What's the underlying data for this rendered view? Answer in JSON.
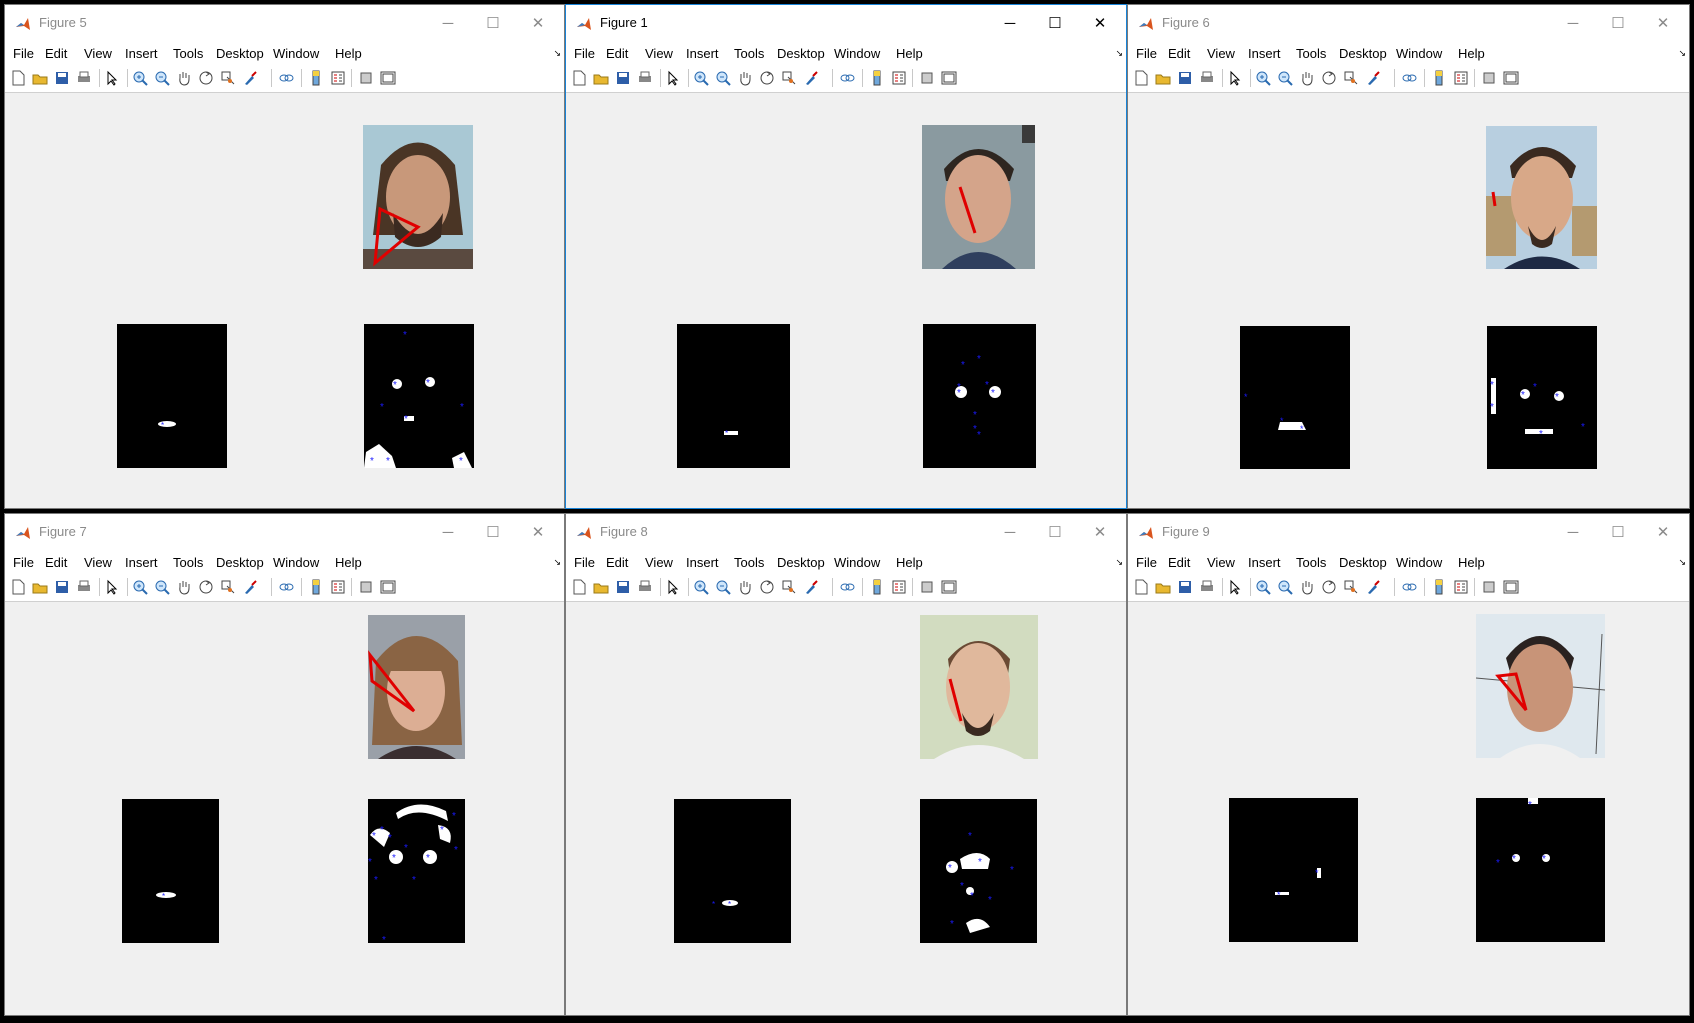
{
  "menu": [
    "File",
    "Edit",
    "View",
    "Insert",
    "Tools",
    "Desktop",
    "Window",
    "Help"
  ],
  "window_controls": {
    "minimize": "─",
    "maximize": "☐",
    "close": "✕"
  },
  "toolbar_icons": [
    "new-figure-icon",
    "open-file-icon",
    "save-figure-icon",
    "print-figure-icon",
    "edit-plot-icon",
    "zoom-in-icon",
    "zoom-out-icon",
    "pan-icon",
    "rotate-3d-icon",
    "data-cursor-icon",
    "brush-icon",
    "link-plot-icon",
    "insert-colorbar-icon",
    "insert-legend-icon",
    "hide-plot-tools-icon",
    "show-plot-tools-icon"
  ],
  "colors": {
    "active_border": "#1883d7",
    "canvas": "#f0f0f0",
    "red_line": "#e00000",
    "blue_marker": "#1a1aff"
  },
  "windows": [
    {
      "title": "Figure 5",
      "active": false
    },
    {
      "title": "Figure 1",
      "active": true
    },
    {
      "title": "Figure 6",
      "active": false
    },
    {
      "title": "Figure 7",
      "active": false
    },
    {
      "title": "Figure 8",
      "active": false
    },
    {
      "title": "Figure 9",
      "active": false
    }
  ]
}
